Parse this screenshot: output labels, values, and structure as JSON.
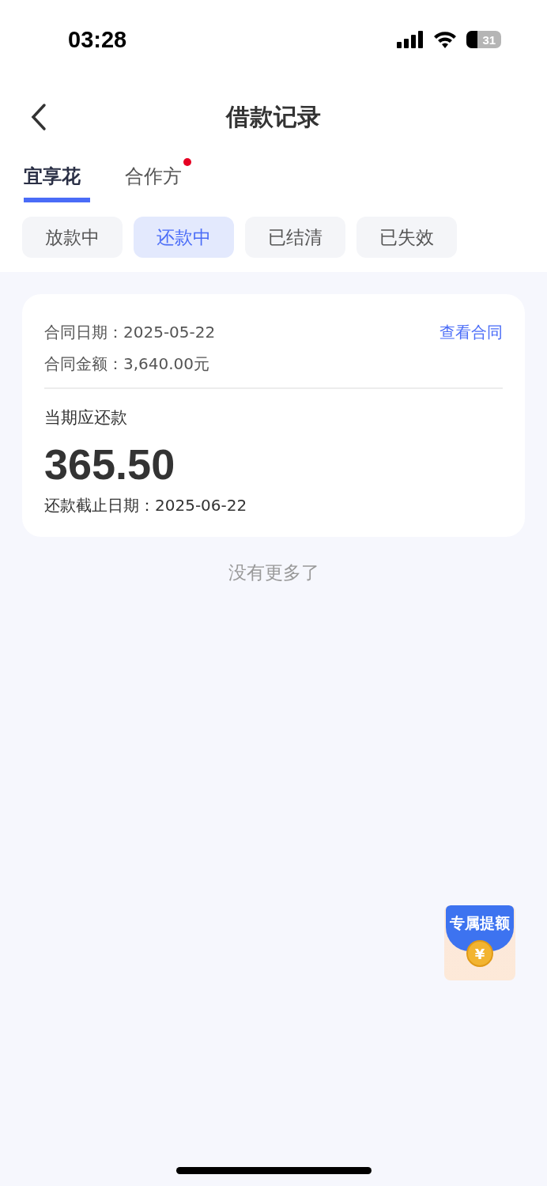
{
  "status_bar": {
    "time": "03:28",
    "battery": "31"
  },
  "header": {
    "title": "借款记录"
  },
  "tabs": [
    {
      "label": "宜享花",
      "selected": true,
      "dot": false
    },
    {
      "label": "合作方",
      "selected": false,
      "dot": true
    }
  ],
  "filters": [
    {
      "label": "放款中",
      "selected": false
    },
    {
      "label": "还款中",
      "selected": true
    },
    {
      "label": "已结清",
      "selected": false
    },
    {
      "label": "已失效",
      "selected": false
    }
  ],
  "card": {
    "contract_date": "合同日期：2025-05-22",
    "view_contract": "查看合同",
    "contract_amount": "合同金额：3,640.00元",
    "due_label": "当期应还款",
    "amount": "365.50",
    "deadline": "还款截止日期：2025-06-22"
  },
  "footer": "没有更多了",
  "promo": {
    "label": "专属提额",
    "coin_symbol": "¥"
  }
}
